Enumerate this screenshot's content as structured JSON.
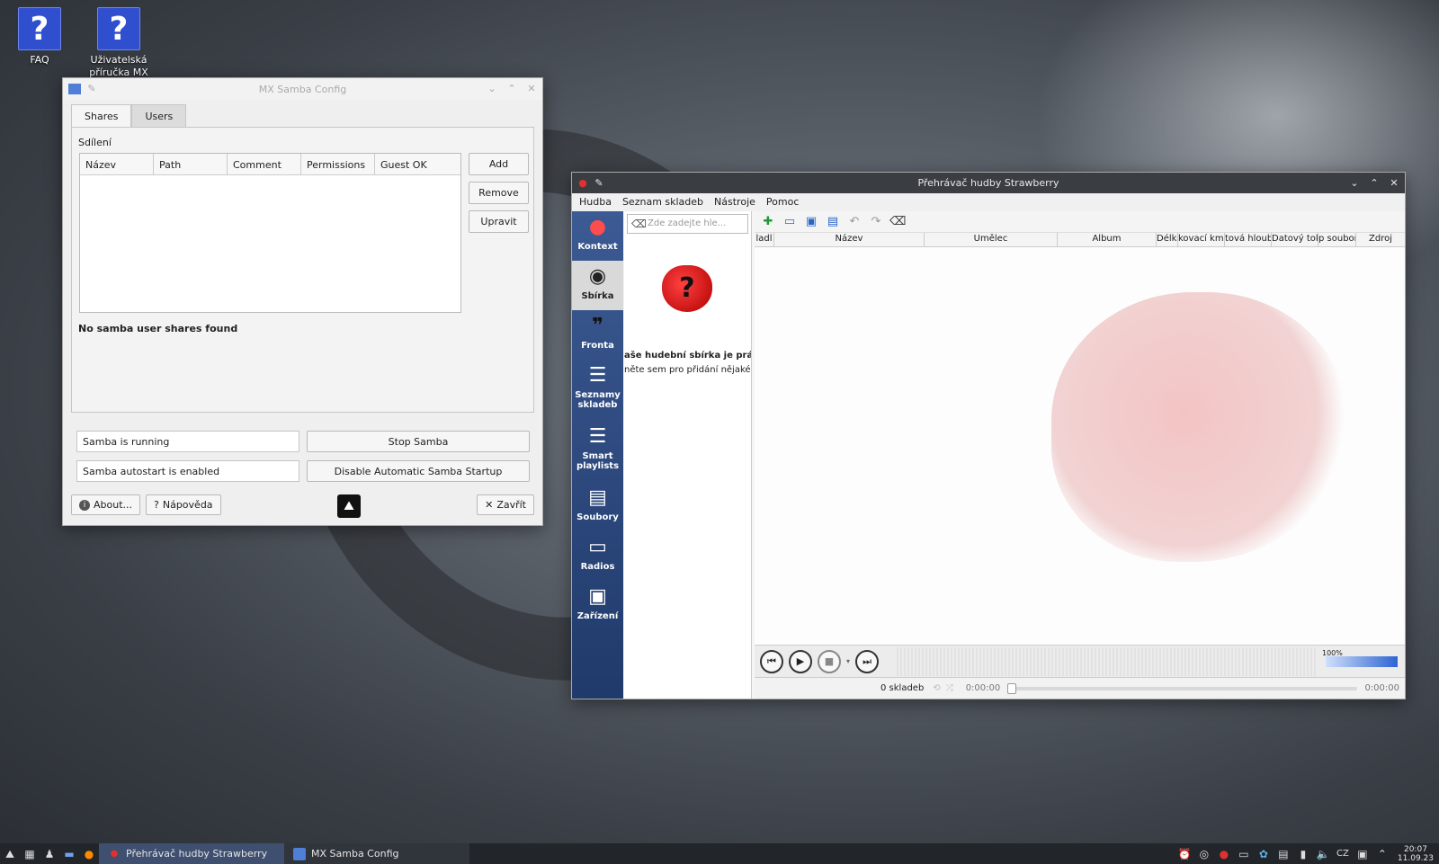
{
  "desktop": {
    "icons": [
      {
        "label": "FAQ",
        "glyph": "?"
      },
      {
        "label": "Uživatelská příručka MX",
        "glyph": "?"
      }
    ]
  },
  "samba": {
    "title": "MX Samba Config",
    "tabs": [
      "Shares",
      "Users"
    ],
    "section_label": "Sdílení",
    "columns": [
      "Název",
      "Path",
      "Comment",
      "Permissions",
      "Guest OK"
    ],
    "buttons": {
      "add": "Add",
      "remove": "Remove",
      "edit": "Upravit"
    },
    "no_shares": "No samba user shares found",
    "status_running": "Samba is running",
    "stop_button": "Stop Samba",
    "status_autostart": "Samba autostart is enabled",
    "disable_button": "Disable Automatic Samba Startup",
    "about_button": "About...",
    "help_button": "Nápověda",
    "close_button": "Zavřít"
  },
  "strawberry": {
    "title": "Přehrávač hudby Strawberry",
    "menu": [
      "Hudba",
      "Seznam skladeb",
      "Nástroje",
      "Pomoc"
    ],
    "side_tabs": [
      {
        "label": "Kontext",
        "icon": "strawberry-icon"
      },
      {
        "label": "Sbírka",
        "icon": "disc-icon"
      },
      {
        "label": "Fronta",
        "icon": "footsteps-icon"
      },
      {
        "label": "Seznamy skladeb",
        "icon": "playlist-icon"
      },
      {
        "label": "Smart playlists",
        "icon": "smart-playlist-icon"
      },
      {
        "label": "Soubory",
        "icon": "files-icon"
      },
      {
        "label": "Radios",
        "icon": "radio-icon"
      },
      {
        "label": "Zařízení",
        "icon": "devices-icon"
      }
    ],
    "search_placeholder": "Zde zadejte hle...",
    "collection_empty_title": "aše hudební sbírka je prázdná",
    "collection_empty_hint": "něte sem pro přidání nějaké hu",
    "playlist_columns": [
      "ladl",
      "Název",
      "Umělec",
      "Album",
      "Délka",
      "kovací kmi",
      "tová hloub",
      "Datový tok",
      "p soubor",
      "Zdroj"
    ],
    "volume": "100%",
    "track_count": "0 skladeb",
    "time_elapsed": "0:00:00",
    "time_total": "0:00:00"
  },
  "taskbar": {
    "tasks": [
      {
        "label": "Přehrávač hudby Strawberry",
        "active": true
      },
      {
        "label": "MX Samba Config",
        "active": false
      }
    ],
    "keyboard_layout": "CZ",
    "clock_time": "20:07",
    "clock_date": "11.09.23"
  }
}
